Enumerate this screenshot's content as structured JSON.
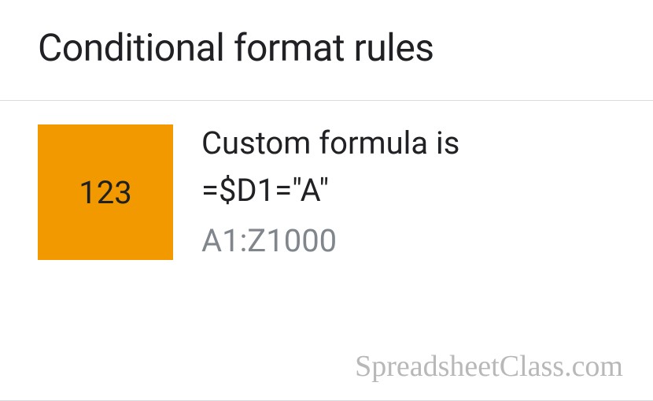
{
  "panel": {
    "title": "Conditional format rules"
  },
  "rule": {
    "preview_text": "123",
    "preview_color": "#f29900",
    "type_label": "Custom formula is",
    "formula": "=$D1=\"A\"",
    "range": "A1:Z1000"
  },
  "watermark": "SpreadsheetClass.com"
}
